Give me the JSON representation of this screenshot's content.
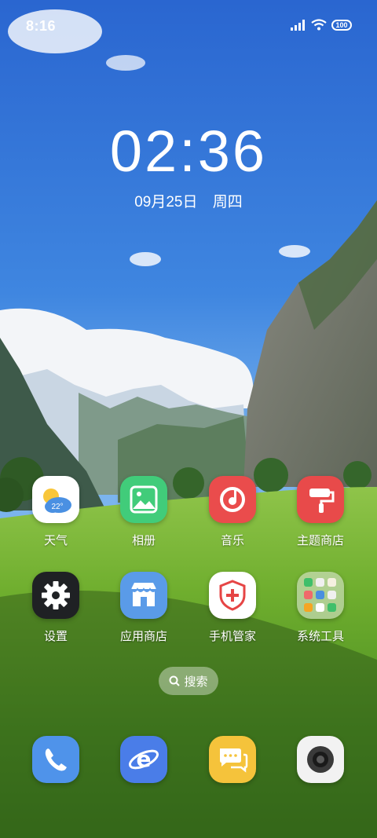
{
  "status_bar": {
    "time": "8:16",
    "battery": "100"
  },
  "lockclock": {
    "time": "02:36",
    "date": "09月25日",
    "weekday": "周四"
  },
  "weather_widget": {
    "temp": "22°"
  },
  "apps_row1": [
    {
      "label": "天气",
      "icon": "weather-icon"
    },
    {
      "label": "相册",
      "icon": "gallery-icon"
    },
    {
      "label": "音乐",
      "icon": "music-icon"
    },
    {
      "label": "主题商店",
      "icon": "theme-store-icon"
    }
  ],
  "apps_row2": [
    {
      "label": "设置",
      "icon": "gear-icon"
    },
    {
      "label": "应用商店",
      "icon": "app-store-icon"
    },
    {
      "label": "手机管家",
      "icon": "security-shield-icon"
    },
    {
      "label": "系统工具",
      "icon": "folder-icon"
    }
  ],
  "search": {
    "label": "搜索"
  },
  "dock": [
    {
      "icon": "phone-icon"
    },
    {
      "icon": "browser-icon"
    },
    {
      "icon": "messages-icon"
    },
    {
      "icon": "camera-icon"
    }
  ]
}
